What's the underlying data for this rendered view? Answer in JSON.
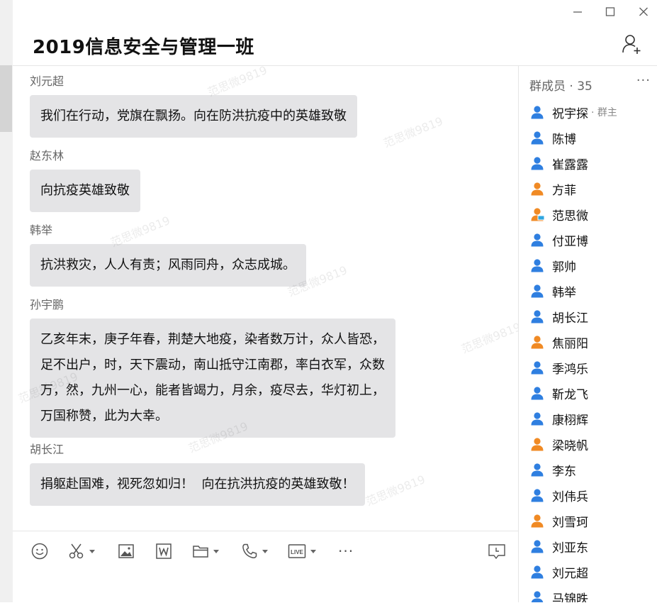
{
  "title": "2019信息安全与管理一班",
  "messages": [
    {
      "sender": "刘元超",
      "text": "我们在行动，党旗在飘扬。向在防洪抗疫中的英雄致敬"
    },
    {
      "sender": "赵东林",
      "text": "向抗疫英雄致敬"
    },
    {
      "sender": "韩举",
      "text": "抗洪救灾，人人有责；风雨同舟，众志成城。"
    },
    {
      "sender": "孙宇鹏",
      "text": "乙亥年末，庚子年春，荆楚大地疫，染者数万计，众人皆恐，\n足不出户，时，天下震动，南山抵守江南郡，率白衣军，众数\n万，然，九州一心，能者皆竭力，月余，疫尽去，华灯初上，\n万国称赞，此为大幸。"
    },
    {
      "sender": "胡长江",
      "text": "捐躯赴国难，视死忽如归！  向在抗洪抗疫的英雄致敬！"
    }
  ],
  "watermark": "范思微9819",
  "toolbar": {
    "icons": [
      "emoji-icon",
      "scissors-icon",
      "image-icon",
      "word-doc-icon",
      "folder-icon",
      "phone-icon",
      "live-icon",
      "more-icon",
      "chat-history-icon"
    ],
    "live_label": "LIVE",
    "more_label": "···"
  },
  "members_panel": {
    "header": "群成员 · 35",
    "more_label": "···",
    "members": [
      {
        "name": "祝宇探",
        "role": "· 群主",
        "color": "blue"
      },
      {
        "name": "陈博",
        "role": "",
        "color": "blue"
      },
      {
        "name": "崔露露",
        "role": "",
        "color": "blue"
      },
      {
        "name": "方菲",
        "role": "",
        "color": "orange"
      },
      {
        "name": "范思微",
        "role": "",
        "color": "orange-pc"
      },
      {
        "name": "付亚博",
        "role": "",
        "color": "blue"
      },
      {
        "name": "郭帅",
        "role": "",
        "color": "blue"
      },
      {
        "name": "韩举",
        "role": "",
        "color": "blue"
      },
      {
        "name": "胡长江",
        "role": "",
        "color": "blue"
      },
      {
        "name": "焦丽阳",
        "role": "",
        "color": "orange"
      },
      {
        "name": "季鸿乐",
        "role": "",
        "color": "blue"
      },
      {
        "name": "靳龙飞",
        "role": "",
        "color": "blue"
      },
      {
        "name": "康栩辉",
        "role": "",
        "color": "blue"
      },
      {
        "name": "梁晓帆",
        "role": "",
        "color": "orange"
      },
      {
        "name": "李东",
        "role": "",
        "color": "blue"
      },
      {
        "name": "刘伟兵",
        "role": "",
        "color": "blue"
      },
      {
        "name": "刘雪珂",
        "role": "",
        "color": "orange"
      },
      {
        "name": "刘亚东",
        "role": "",
        "color": "blue"
      },
      {
        "name": "刘元超",
        "role": "",
        "color": "blue"
      },
      {
        "name": "马锦昳",
        "role": "",
        "color": "blue"
      }
    ]
  },
  "colors": {
    "blue": "#2f7fe0",
    "orange": "#f08a24",
    "bubble": "#e4e4e6",
    "pc_badge": "#2fa6e0"
  }
}
